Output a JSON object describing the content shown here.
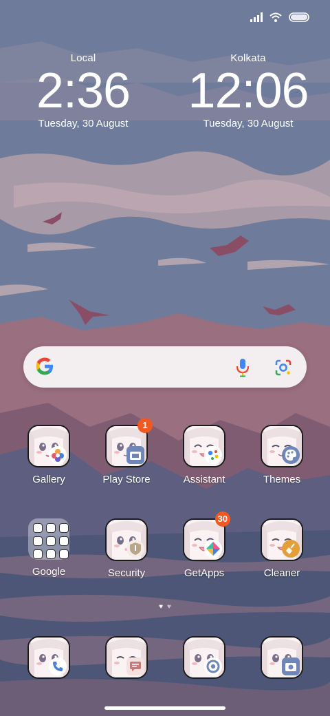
{
  "status_bar": {
    "icons": [
      "signal-icon",
      "wifi-icon",
      "battery-icon"
    ]
  },
  "clocks": [
    {
      "city": "Local",
      "time": "2:36",
      "date": "Tuesday, 30 August"
    },
    {
      "city": "Kolkata",
      "time": "12:06",
      "date": "Tuesday, 30 August"
    }
  ],
  "search_bar": {
    "icons": [
      "google-logo-icon",
      "microphone-icon",
      "google-lens-icon"
    ]
  },
  "apps": [
    {
      "label": "Gallery",
      "icon": "gallery-icon"
    },
    {
      "label": "Play Store",
      "icon": "play-store-icon",
      "badge": "1"
    },
    {
      "label": "Assistant",
      "icon": "assistant-icon"
    },
    {
      "label": "Themes",
      "icon": "themes-icon"
    },
    {
      "label": "Google",
      "icon": "folder-icon"
    },
    {
      "label": "Security",
      "icon": "security-icon"
    },
    {
      "label": "GetApps",
      "icon": "getapps-icon",
      "badge": "30"
    },
    {
      "label": "Cleaner",
      "icon": "cleaner-icon"
    }
  ],
  "dock": [
    {
      "icon": "phone-icon"
    },
    {
      "icon": "messages-icon"
    },
    {
      "icon": "chrome-icon"
    },
    {
      "icon": "camera-icon"
    }
  ],
  "page_indicator": {
    "pages": 2,
    "active": 1
  },
  "colors": {
    "sky": "#6f7b9a",
    "cloud": "#a89aa6",
    "mountain": "#9a6f80",
    "badge": "#f05a22"
  }
}
